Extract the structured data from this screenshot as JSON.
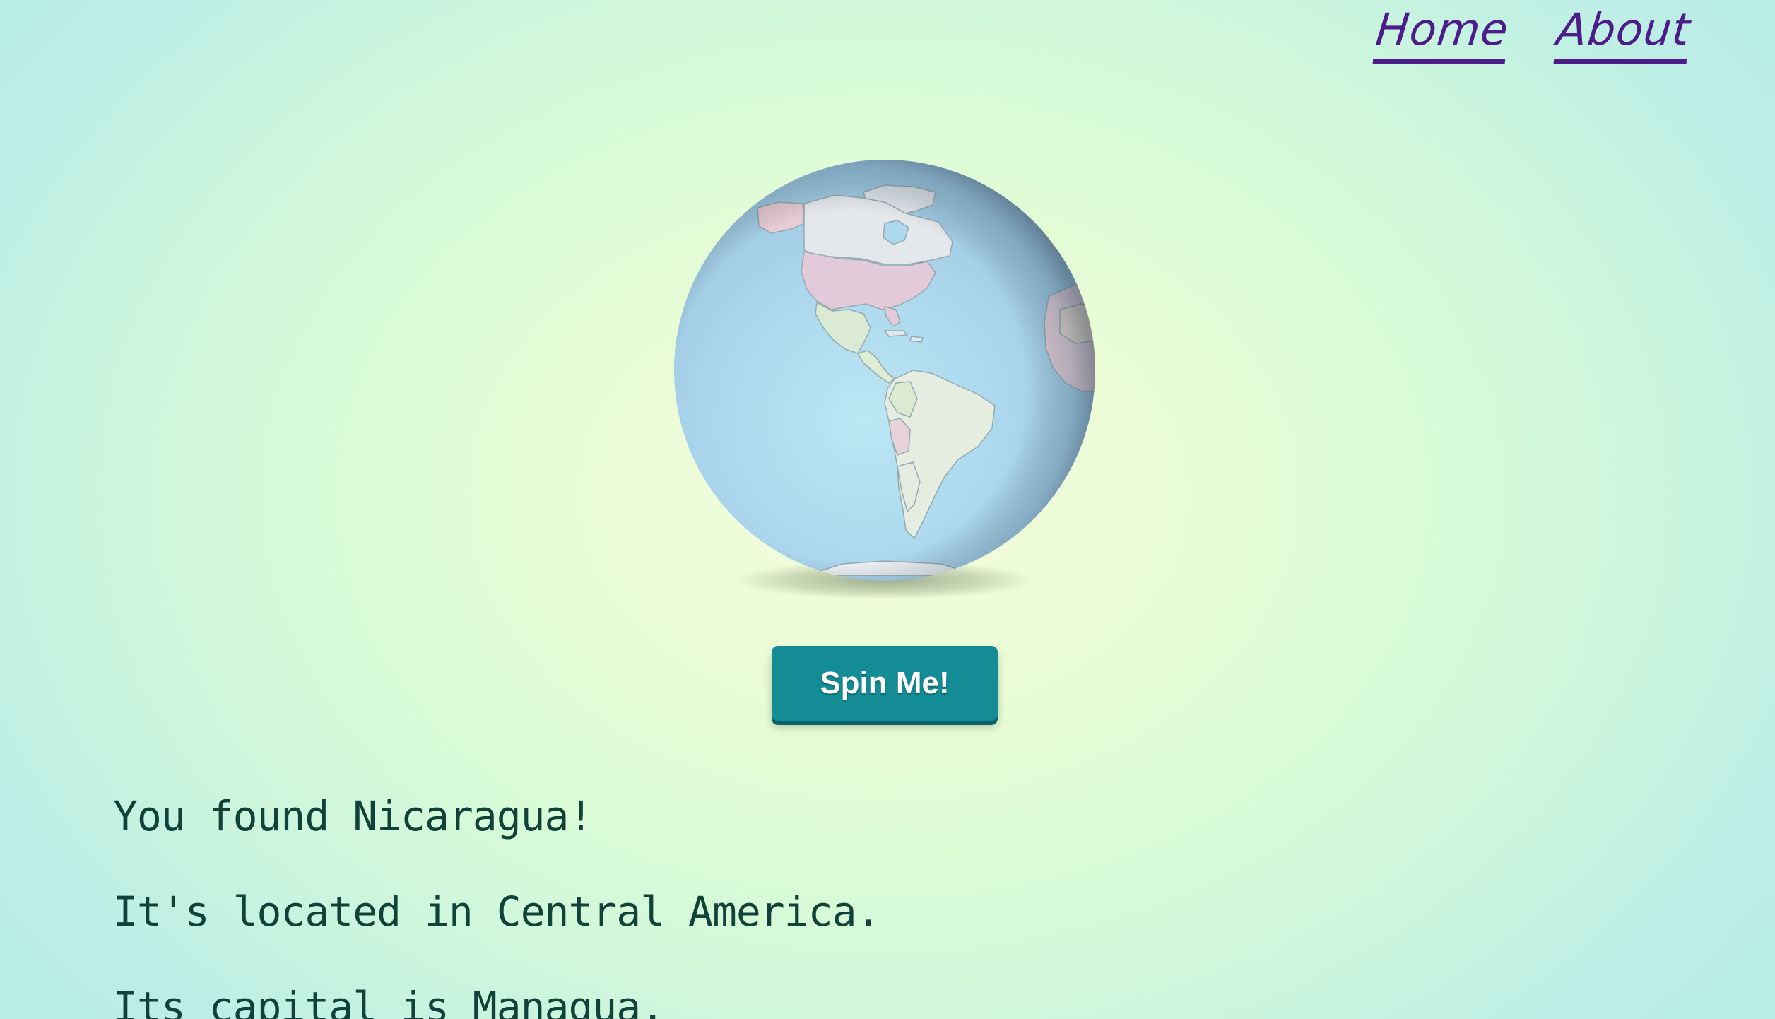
{
  "nav": {
    "home_label": "Home",
    "about_label": "About",
    "link_color": "#4b1c8a"
  },
  "globe": {
    "icon": "globe-icon",
    "ocean_color": "#a8d6ee",
    "highlighted_country": "Nicaragua"
  },
  "spin_button": {
    "label": "Spin Me!",
    "color": "#138c96"
  },
  "result": {
    "found_text": "You found Nicaragua!",
    "region_text": "It's located in Central America.",
    "capital_text": "Its capital is Managua.",
    "text_color": "#10423a"
  }
}
